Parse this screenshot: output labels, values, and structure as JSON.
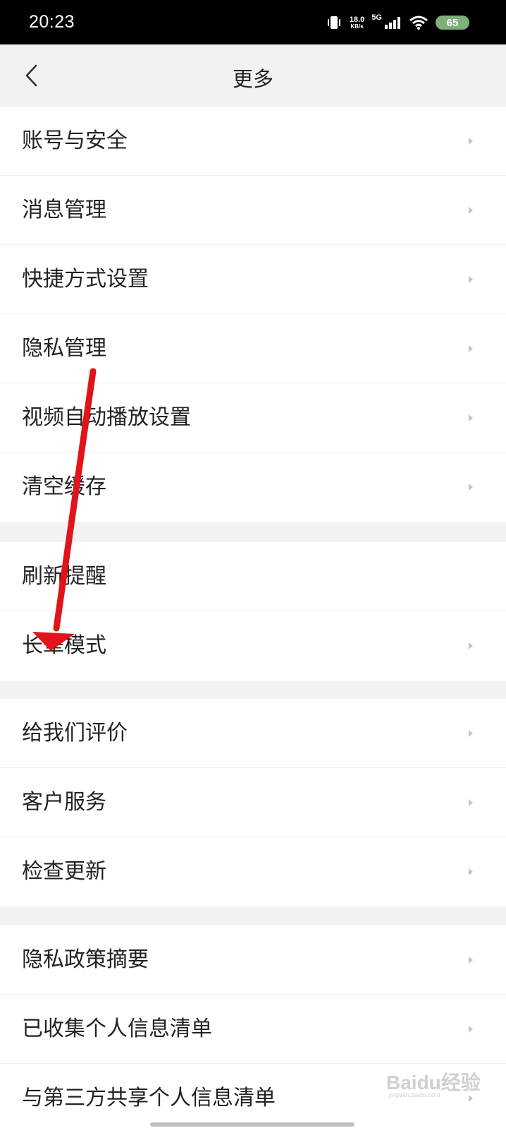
{
  "status_bar": {
    "time": "20:23",
    "speed_value": "18.0",
    "speed_unit": "KB/s",
    "network_type": "5G",
    "battery": "65",
    "icons": [
      "vibrate-icon",
      "signal-icon",
      "wifi-icon",
      "battery-icon"
    ]
  },
  "header": {
    "title": "更多",
    "back_icon": "chevron-left-icon"
  },
  "groups": [
    {
      "items": [
        {
          "label": "账号与安全"
        },
        {
          "label": "消息管理"
        },
        {
          "label": "快捷方式设置"
        },
        {
          "label": "隐私管理"
        },
        {
          "label": "视频自动播放设置"
        },
        {
          "label": "清空缓存"
        }
      ]
    },
    {
      "items": [
        {
          "label": "刷新提醒"
        },
        {
          "label": "长辈模式"
        }
      ]
    },
    {
      "items": [
        {
          "label": "给我们评价"
        },
        {
          "label": "客户服务"
        },
        {
          "label": "检查更新"
        }
      ]
    },
    {
      "items": [
        {
          "label": "隐私政策摘要"
        },
        {
          "label": "已收集个人信息清单"
        },
        {
          "label": "与第三方共享个人信息清单"
        }
      ]
    }
  ],
  "chevron_icon": "chevron-right-icon",
  "annotation": {
    "color": "#e0141a",
    "target": "长辈模式"
  },
  "watermark": {
    "text": "Baidu经验",
    "sub": "jingyan.baidu.com"
  }
}
